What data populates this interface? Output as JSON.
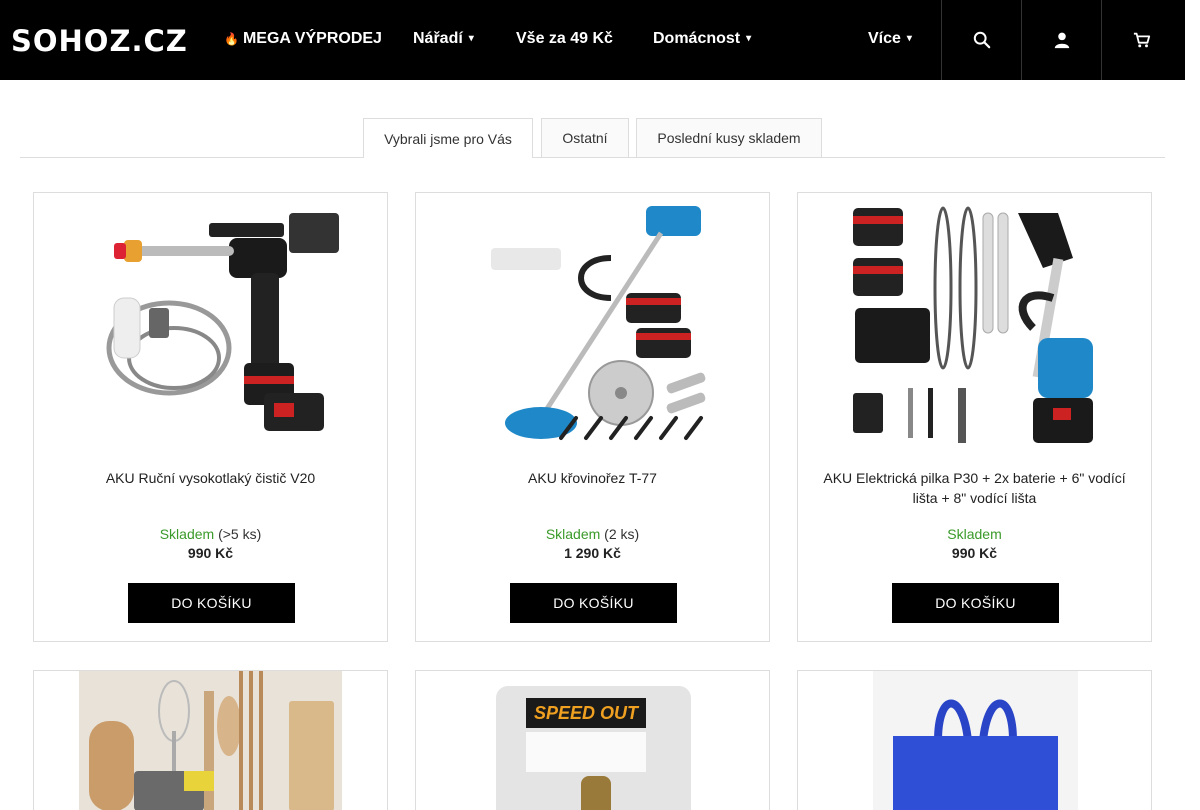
{
  "header": {
    "logo": "SOHOZ.CZ",
    "nav": [
      {
        "label": "MEGA VÝPRODEJ",
        "icon": "fire-icon"
      },
      {
        "label": "Nářadí",
        "caret": "▾"
      },
      {
        "label": "Vše za 49 Kč"
      },
      {
        "label": "Domácnost",
        "caret": "▾"
      },
      {
        "label": "Více",
        "caret": "▾"
      }
    ],
    "icons": [
      "search-icon",
      "user-icon",
      "cart-icon"
    ]
  },
  "tabs": [
    {
      "label": "Vybrali jsme pro Vás",
      "active": true
    },
    {
      "label": "Ostatní",
      "active": false
    },
    {
      "label": "Poslední kusy skladem",
      "active": false
    }
  ],
  "products": [
    {
      "name": "AKU Ruční vysokotlaký čistič V20",
      "stock": "Skladem",
      "stock_qty": "(>5 ks)",
      "price": "990 Kč",
      "button": "DO KOŠÍKU",
      "image": "pressure-washer"
    },
    {
      "name": "AKU křovinořez T-77",
      "stock": "Skladem",
      "stock_qty": "(2 ks)",
      "price": "1 290 Kč",
      "button": "DO KOŠÍKU",
      "image": "grass-trimmer"
    },
    {
      "name": "AKU Elektrická pilka P30 + 2x baterie + 6\" vodící lišta + 8\" vodící lišta",
      "stock": "Skladem",
      "stock_qty": "",
      "price": "990 Kč",
      "button": "DO KOŠÍKU",
      "image": "chainsaw"
    }
  ],
  "products_row2": [
    {
      "image": "kitchen-utensils"
    },
    {
      "image": "screw-extractor",
      "label": "SPEED OUT"
    },
    {
      "image": "blue-bag"
    }
  ],
  "colors": {
    "header": "#000000",
    "stock": "#3a9a2a",
    "button": "#000000",
    "border": "#dddddd"
  }
}
